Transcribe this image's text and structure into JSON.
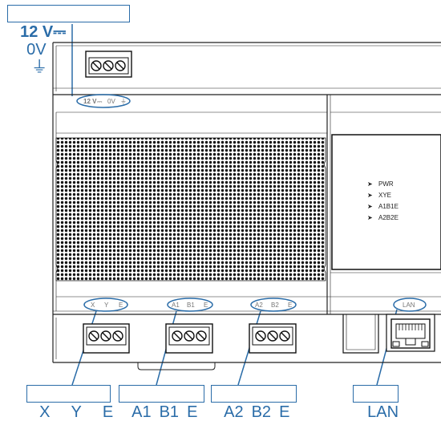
{
  "callouts": {
    "power": {
      "v12": "12 V",
      "ov": "0V"
    },
    "xye": {
      "x": "X",
      "y": "Y",
      "e": "E"
    },
    "a1b1e": {
      "a": "A1",
      "b": "B1",
      "e": "E"
    },
    "a2b2e": {
      "a": "A2",
      "b": "B2",
      "e": "E"
    },
    "lan": "LAN"
  },
  "device_labels": {
    "power": {
      "v12": "12 V",
      "ov": "0V"
    },
    "xye": [
      "X",
      "Y",
      "E"
    ],
    "a1b1e": [
      "A1",
      "B1",
      "E"
    ],
    "a2b2e": [
      "A2",
      "B2",
      "E"
    ],
    "lan": "LAN"
  },
  "leds": [
    "PWR",
    "XYE",
    "A1B1E",
    "A2B2E"
  ],
  "colors": {
    "accent": "#2a6ca8",
    "outline": "#222222",
    "label": "#777777"
  }
}
